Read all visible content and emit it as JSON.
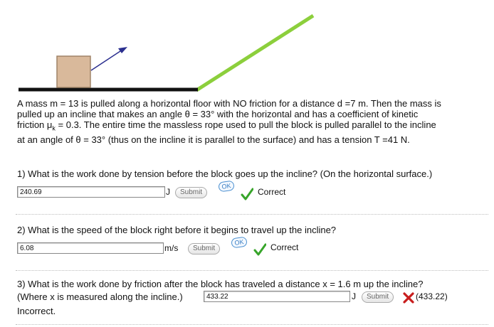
{
  "problem": {
    "line1": "A mass m = 13 is pulled along a horizontal floor with NO friction for a distance d =7 m. Then the mass is",
    "line2": "pulled up an incline that makes an angle θ = 33° with the horizontal and has a coefficient of kinetic",
    "line3_prefix": "friction μ",
    "line3_sub": "k",
    "line3_rest": " = 0.3. The entire time the massless rope used to pull the block is pulled parallel to the incline",
    "line4": "at an angle of θ = 33° (thus on the incline it is parallel to the surface) and has a tension T =41 N."
  },
  "figure": {
    "colors": {
      "block": "#d9b99b",
      "block_border": "#a08468",
      "floor": "#111111",
      "incline": "#8ccf3c",
      "arrow": "#2b2f8f"
    }
  },
  "questions": [
    {
      "text": "1) What is the work done by tension before the block goes up the incline? (On the horizontal surface.)",
      "answer": "240.69",
      "unit": "J",
      "submit": "Submit",
      "ok": "OK",
      "status": "Correct"
    },
    {
      "text": "2) What is the speed of the block right before it begins to travel up the incline?",
      "answer": "6.08",
      "unit": "m/s",
      "submit": "Submit",
      "ok": "OK",
      "status": "Correct"
    },
    {
      "text_line1": "3) What is the work done by friction after the block has traveled a distance x = 1.6 m up the incline?",
      "text_line2": "(Where x is measured along the incline.)",
      "answer": "433.22",
      "unit": "J",
      "submit": "Submit",
      "feedback": "(433.22)",
      "status": "Incorrect."
    }
  ],
  "status_colors": {
    "correct": "#37a52a",
    "incorrect": "#c81d1d"
  }
}
